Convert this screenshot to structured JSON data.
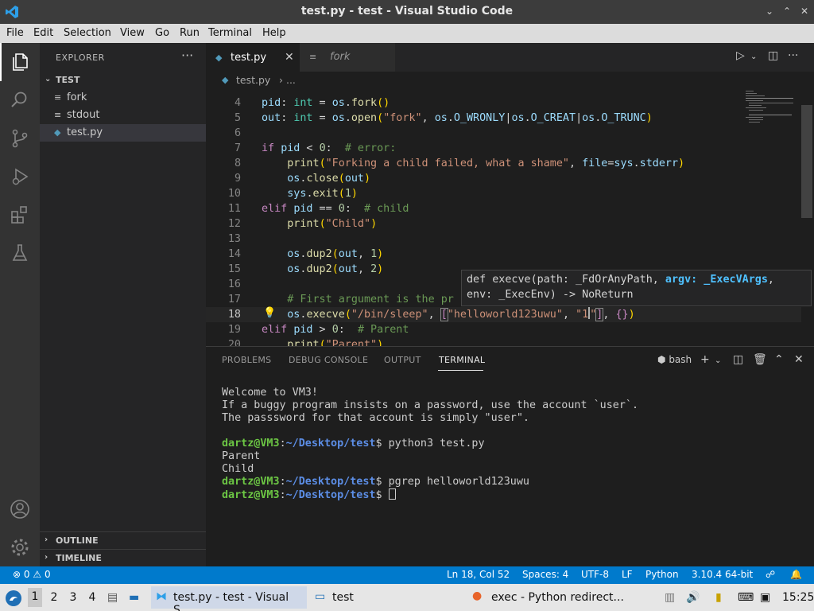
{
  "window": {
    "title": "test.py - test - Visual Studio Code",
    "controls": [
      "⌃",
      "⌄",
      "✕"
    ]
  },
  "menu": [
    "File",
    "Edit",
    "Selection",
    "View",
    "Go",
    "Run",
    "Terminal",
    "Help"
  ],
  "activity_bar": [
    "files-icon",
    "search-icon",
    "source-control-icon",
    "run-debug-icon",
    "extensions-icon",
    "testing-icon",
    "account-icon",
    "gear-icon"
  ],
  "sidebar": {
    "title": "EXPLORER",
    "more": "···",
    "folder": "TEST",
    "files": [
      "fork",
      "stdout",
      "test.py"
    ],
    "selected_file": "test.py",
    "outline": "OUTLINE",
    "timeline": "TIMELINE"
  },
  "tabs": [
    {
      "label": "test.py",
      "active": true
    },
    {
      "label": "fork",
      "active": false
    }
  ],
  "breadcrumb": {
    "file": "test.py",
    "rest": "..."
  },
  "code": {
    "current_line": 18,
    "lines": [
      {
        "n": "4",
        "text": "pid: int = os.fork()"
      },
      {
        "n": "5",
        "text": "out: int = os.open(\"fork\", os.O_WRONLY|os.O_CREAT|os.O_TRUNC)"
      },
      {
        "n": "6",
        "text": ""
      },
      {
        "n": "7",
        "text": "if pid < 0:  # error:"
      },
      {
        "n": "8",
        "text": "    print(\"Forking a child failed, what a shame\", file=sys.stderr)"
      },
      {
        "n": "9",
        "text": "    os.close(out)"
      },
      {
        "n": "10",
        "text": "    sys.exit(1)"
      },
      {
        "n": "11",
        "text": "elif pid == 0:  # child"
      },
      {
        "n": "12",
        "text": "    print(\"Child\")"
      },
      {
        "n": "13",
        "text": ""
      },
      {
        "n": "14",
        "text": "    os.dup2(out, 1)"
      },
      {
        "n": "15",
        "text": "    os.dup2(out, 2)"
      },
      {
        "n": "16",
        "text": ""
      },
      {
        "n": "17",
        "text": "    # First argument is the pr"
      },
      {
        "n": "18",
        "text": "    os.execve(\"/bin/sleep\", [\"helloworld123uwu\", \"1\"], {})"
      },
      {
        "n": "19",
        "text": "elif pid > 0:  # Parent"
      },
      {
        "n": "20",
        "text": "    print(\"Parent\")"
      }
    ]
  },
  "hover": {
    "line1_pre": "def execve(path: _FdOrAnyPath, ",
    "line1_hl": "argv: _ExecVArgs",
    "line1_post": ",",
    "line2": "env: _ExecEnv) -> NoReturn"
  },
  "panel": {
    "tabs": [
      "PROBLEMS",
      "DEBUG CONSOLE",
      "OUTPUT",
      "TERMINAL"
    ],
    "active_tab": "TERMINAL",
    "shell": "bash",
    "terminal": {
      "motd": [
        "Welcome to VM3!",
        "If a buggy program insists on a password, use the account `user`.",
        "The passsword for that account is simply \"user\"."
      ],
      "user": "dartz@VM3",
      "path": "~/Desktop/test",
      "cmd1": "python3 test.py",
      "out1": [
        "Parent",
        "Child"
      ],
      "cmd2": "pgrep helloworld123uwu"
    }
  },
  "status": {
    "errors": "0",
    "warnings": "0",
    "position": "Ln 18, Col 52",
    "spaces": "Spaces: 4",
    "encoding": "UTF-8",
    "eol": "LF",
    "language": "Python",
    "interpreter": "3.10.4 64-bit"
  },
  "taskbar": {
    "workspaces": [
      "1",
      "2",
      "3",
      "4"
    ],
    "active_workspace": "1",
    "tasks": [
      "test.py - test - Visual S...",
      "test",
      "exec - Python redirect..."
    ],
    "clock": "15:25"
  },
  "colors": {
    "accent": "#007acc",
    "title_bar": "#3c3c3c",
    "sidebar": "#252526",
    "editor": "#1e1e1e"
  }
}
